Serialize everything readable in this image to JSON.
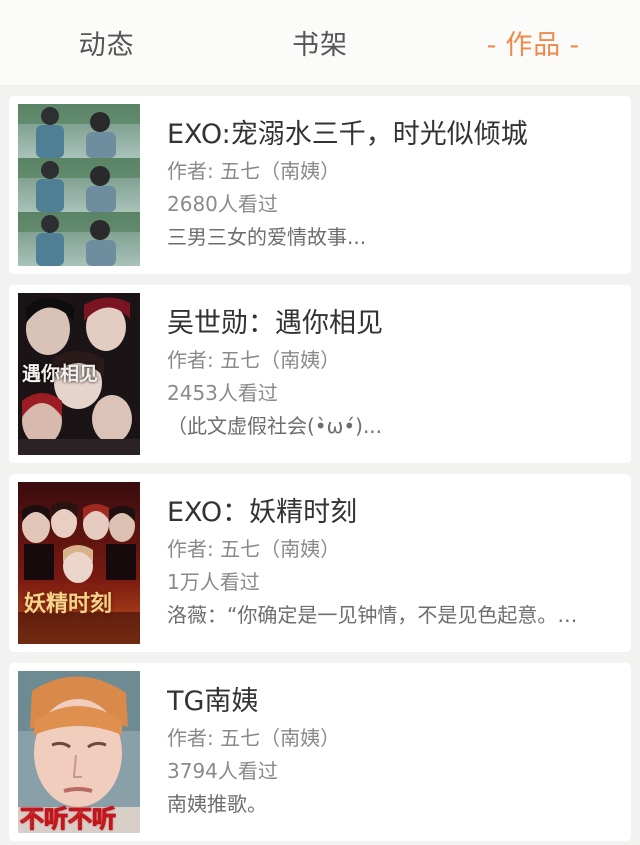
{
  "tabs": [
    {
      "label": "动态",
      "active": false
    },
    {
      "label": "书架",
      "active": false
    },
    {
      "label": "作品",
      "active": true,
      "decoration": "-"
    }
  ],
  "accent_color": "#f08a4b",
  "works": [
    {
      "title": "EXO:宠溺水三千，时光似倾城",
      "author": "作者: 五七（南姨）",
      "views": "2680人看过",
      "desc": "三男三女的爱情故事..."
    },
    {
      "title": "吴世勋：遇你相见",
      "author": "作者: 五七（南姨）",
      "views": "2453人看过",
      "desc": "（此文虚假社会(•̀ω•́)...",
      "cover_text": "遇你相见"
    },
    {
      "title": "EXO：妖精时刻",
      "author": "作者: 五七（南姨）",
      "views": "1万人看过",
      "desc": "洛薇：“你确定是一见钟情，不是见色起意。…",
      "cover_text": "妖精时刻"
    },
    {
      "title": "TG南姨",
      "author": "作者: 五七（南姨）",
      "views": "3794人看过",
      "desc": "南姨推歌。",
      "cover_text": "不听不听"
    }
  ]
}
